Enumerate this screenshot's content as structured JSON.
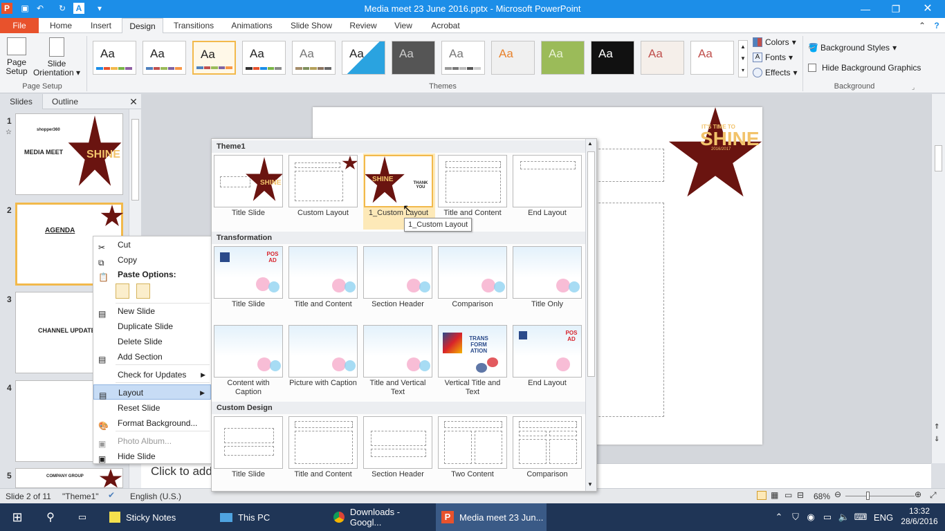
{
  "window": {
    "title": "Media meet  23 June 2016.pptx - Microsoft PowerPoint"
  },
  "tabs": [
    "File",
    "Home",
    "Insert",
    "Design",
    "Transitions",
    "Animations",
    "Slide Show",
    "Review",
    "View",
    "Acrobat"
  ],
  "ribbon": {
    "page_setup": {
      "page_setup_line1": "Page",
      "page_setup_line2": "Setup",
      "orientation_line1": "Slide",
      "orientation_line2": "Orientation",
      "group": "Page Setup"
    },
    "themes": {
      "group": "Themes",
      "thumb_text": "Aa"
    },
    "theme_opts": {
      "colors": "Colors",
      "fonts": "Fonts",
      "effects": "Effects"
    },
    "background": {
      "styles": "Background Styles",
      "hide": "Hide Background Graphics",
      "group": "Background"
    }
  },
  "panel": {
    "tab_slides": "Slides",
    "tab_outline": "Outline"
  },
  "slides": [
    {
      "num": "1",
      "title": "MEDIA MEET",
      "brand": "shopper360"
    },
    {
      "num": "2",
      "title": "AGENDA"
    },
    {
      "num": "3",
      "title": "CHANNEL UPDATE"
    },
    {
      "num": "4",
      "title": ""
    },
    {
      "num": "5",
      "title": "COMPANY GROUP"
    }
  ],
  "context_menu": {
    "cut": "Cut",
    "copy": "Copy",
    "paste_options": "Paste Options:",
    "new_slide": "New Slide",
    "duplicate": "Duplicate Slide",
    "delete": "Delete Slide",
    "add_section": "Add Section",
    "check_updates": "Check for Updates",
    "layout": "Layout",
    "reset": "Reset Slide",
    "format_bg": "Format Background...",
    "photo_album": "Photo Album...",
    "hide": "Hide Slide"
  },
  "gallery": {
    "sections": [
      "Theme1",
      "Transformation",
      "Custom Design"
    ],
    "theme1": [
      "Title Slide",
      "Custom Layout",
      "1_Custom Layout",
      "Title and Content",
      "End Layout"
    ],
    "transformation_row1": [
      "Title Slide",
      "Title and Content",
      "Section Header",
      "Comparison",
      "Title Only"
    ],
    "transformation_row2": [
      "Content with Caption",
      "Picture with Caption",
      "Title and Vertical Text",
      "Vertical Title and Text",
      "End Layout"
    ],
    "custom_design": [
      "Title Slide",
      "Title and Content",
      "Section Header",
      "Two Content",
      "Comparison"
    ],
    "tooltip": "1_Custom Layout",
    "shine_small": "SHINE",
    "thank_you": "THANK YOU",
    "trans_text": "TRANS FORM ATION",
    "posad": "POS AD"
  },
  "slide_art": {
    "line1": "IT'S TIME TO",
    "line2": "SHINE",
    "years": "2016/2017"
  },
  "notes": {
    "placeholder": "Click to add"
  },
  "status": {
    "slide_of": "Slide 2 of 11",
    "theme": "\"Theme1\"",
    "language": "English (U.S.)",
    "zoom": "68%"
  },
  "taskbar": {
    "sticky": "Sticky Notes",
    "thispc": "This PC",
    "chrome": "Downloads - Googl...",
    "ppt": "Media meet  23 Jun...",
    "lang": "ENG",
    "time": "13:32",
    "date": "28/6/2016"
  },
  "colors": {
    "accent_orange": "#e8522c",
    "title_blue": "#1c8ee8",
    "star_maroon": "#6a1410",
    "selection_gold": "#f2b94b"
  }
}
